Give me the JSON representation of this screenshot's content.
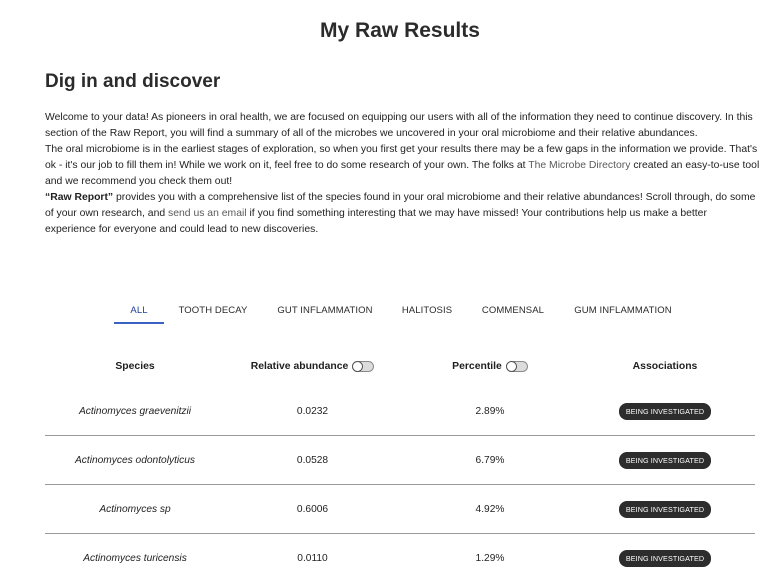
{
  "page_title": "My Raw Results",
  "section_title": "Dig in and discover",
  "intro": {
    "p1_text": "Welcome to your data! As pioneers in oral health, we are focused on equipping our users with all of the information they need to continue discovery. In this section of the Raw Report, you will find a summary of all of the microbes we uncovered in your oral microbiome and their relative abundances.",
    "p2_before": "The oral microbiome is in the earliest stages of exploration, so when you first get your results there may be a few gaps in the information we provide. That's ok - it's our job to fill them in! While we work on it, feel free to do some research of your own. The folks at ",
    "p2_link": "The Microbe Directory",
    "p2_after": " created an easy-to-use tool and we recommend you check them out!",
    "p3_bold": "“Raw Report”",
    "p3_before": " provides you with a comprehensive list of the species found in your oral microbiome and their relative abundances! Scroll through, do some of your own research, and ",
    "p3_link": "send us an email",
    "p3_after": " if you find something interesting that we may have missed! Your contributions help us make a better experience for everyone and could lead to new discoveries."
  },
  "tabs": [
    {
      "label": "ALL",
      "active": true
    },
    {
      "label": "TOOTH DECAY",
      "active": false
    },
    {
      "label": "GUT INFLAMMATION",
      "active": false
    },
    {
      "label": "HALITOSIS",
      "active": false
    },
    {
      "label": "COMMENSAL",
      "active": false
    },
    {
      "label": "GUM INFLAMMATION",
      "active": false
    }
  ],
  "table": {
    "headers": {
      "species": "Species",
      "relative_abundance": "Relative abundance",
      "percentile": "Percentile",
      "associations": "Associations"
    },
    "toggles": {
      "relative_abundance_on": false,
      "percentile_on": false
    },
    "rows": [
      {
        "species": "Actinomyces graevenitzii",
        "relative_abundance": "0.0232",
        "percentile": "2.89%",
        "association": "BEING INVESTIGATED"
      },
      {
        "species": "Actinomyces odontolyticus",
        "relative_abundance": "0.0528",
        "percentile": "6.79%",
        "association": "BEING INVESTIGATED"
      },
      {
        "species": "Actinomyces sp",
        "relative_abundance": "0.6006",
        "percentile": "4.92%",
        "association": "BEING INVESTIGATED"
      },
      {
        "species": "Actinomyces turicensis",
        "relative_abundance": "0.0110",
        "percentile": "1.29%",
        "association": "BEING INVESTIGATED"
      }
    ]
  },
  "colors": {
    "accent": "#3a61c4",
    "badge_bg": "#2d2d2d",
    "badge_text": "#ffffff",
    "link": "#5a5a5a"
  }
}
